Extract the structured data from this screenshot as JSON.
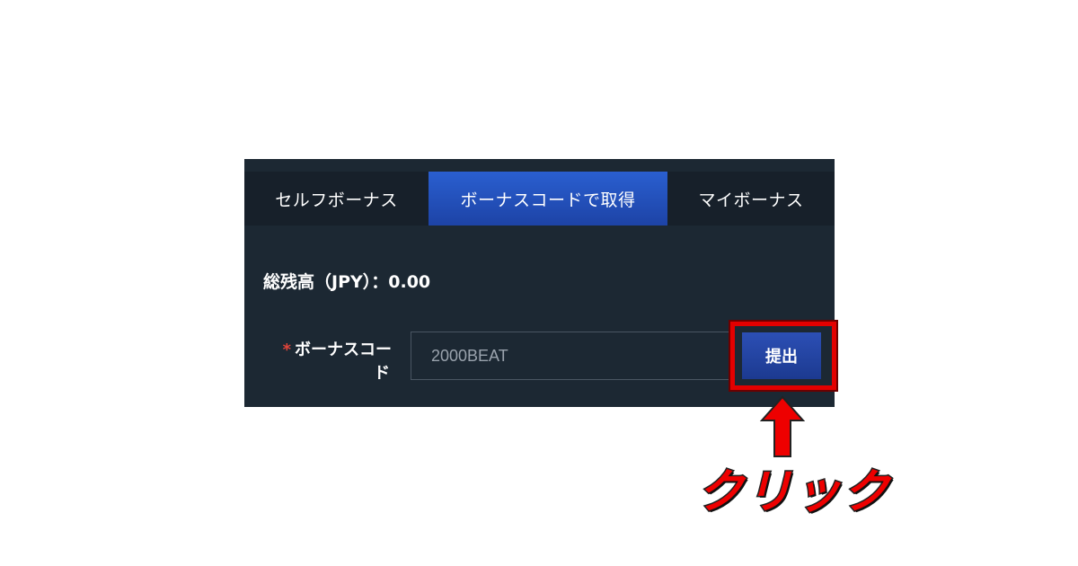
{
  "tabs": [
    {
      "label": "セルフボーナス",
      "active": false
    },
    {
      "label": "ボーナスコードで取得",
      "active": true
    },
    {
      "label": "マイボーナス",
      "active": false
    }
  ],
  "balance": {
    "text": "総残高（JPY）：0.00"
  },
  "bonus_code": {
    "required_mark": "*",
    "label_line1": "ボーナスコー",
    "label_line2": "ド",
    "value": "2000BEAT"
  },
  "submit": {
    "label": "提出"
  },
  "annotation": {
    "text": "クリック",
    "color": "#e30000"
  },
  "colors": {
    "panel_bg": "#1c2833",
    "active_tab": "#2a5fd0",
    "button": "#2c4fb5"
  }
}
